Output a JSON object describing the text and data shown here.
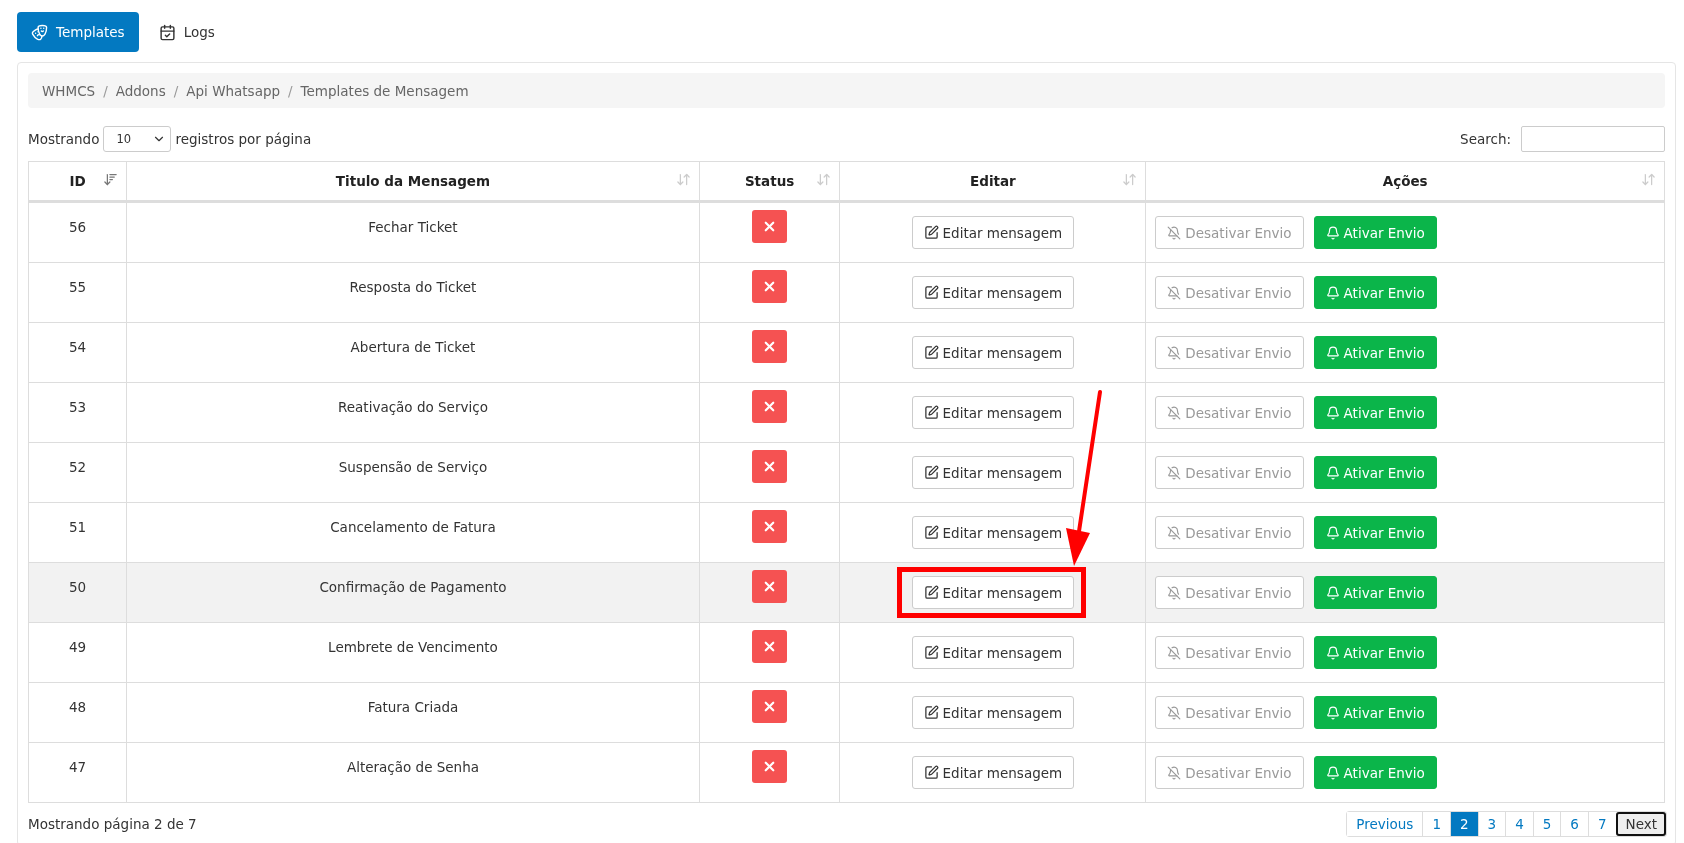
{
  "tabs": [
    {
      "label": "Templates",
      "selected": true
    },
    {
      "label": "Logs",
      "selected": false
    }
  ],
  "breadcrumb": {
    "items": [
      "WHMCS",
      "Addons",
      "Api Whatsapp",
      "Templates de Mensagem"
    ],
    "separators": [
      "/",
      "/",
      "/"
    ]
  },
  "length_control": {
    "prefix": "Mostrando",
    "value": "10",
    "suffix": "registros por página"
  },
  "search": {
    "label": "Search:"
  },
  "table": {
    "columns": [
      {
        "label": "ID",
        "sorted": true
      },
      {
        "label": "Titulo da Mensagem",
        "sorted": false
      },
      {
        "label": "Status",
        "sorted": false
      },
      {
        "label": "Editar",
        "sorted": false
      },
      {
        "label": "Ações",
        "sorted": false
      }
    ],
    "rows": [
      {
        "id": "56",
        "title": "Fechar Ticket",
        "active": false,
        "edit": "Editar mensagem",
        "disable": "Desativar Envio",
        "enable": "Ativar Envio",
        "highlighted": false,
        "annotated": false
      },
      {
        "id": "55",
        "title": "Resposta do Ticket",
        "active": false,
        "edit": "Editar mensagem",
        "disable": "Desativar Envio",
        "enable": "Ativar Envio",
        "highlighted": false,
        "annotated": false
      },
      {
        "id": "54",
        "title": "Abertura de Ticket",
        "active": false,
        "edit": "Editar mensagem",
        "disable": "Desativar Envio",
        "enable": "Ativar Envio",
        "highlighted": false,
        "annotated": false
      },
      {
        "id": "53",
        "title": "Reativação do Serviço",
        "active": false,
        "edit": "Editar mensagem",
        "disable": "Desativar Envio",
        "enable": "Ativar Envio",
        "highlighted": false,
        "annotated": false
      },
      {
        "id": "52",
        "title": "Suspensão de Serviço",
        "active": false,
        "edit": "Editar mensagem",
        "disable": "Desativar Envio",
        "enable": "Ativar Envio",
        "highlighted": false,
        "annotated": false
      },
      {
        "id": "51",
        "title": "Cancelamento de Fatura",
        "active": false,
        "edit": "Editar mensagem",
        "disable": "Desativar Envio",
        "enable": "Ativar Envio",
        "highlighted": false,
        "annotated": false
      },
      {
        "id": "50",
        "title": "Confirmação de Pagamento",
        "active": false,
        "edit": "Editar mensagem",
        "disable": "Desativar Envio",
        "enable": "Ativar Envio",
        "highlighted": true,
        "annotated": true
      },
      {
        "id": "49",
        "title": "Lembrete de Vencimento",
        "active": false,
        "edit": "Editar mensagem",
        "disable": "Desativar Envio",
        "enable": "Ativar Envio",
        "highlighted": false,
        "annotated": false
      },
      {
        "id": "48",
        "title": "Fatura Criada",
        "active": false,
        "edit": "Editar mensagem",
        "disable": "Desativar Envio",
        "enable": "Ativar Envio",
        "highlighted": false,
        "annotated": false
      },
      {
        "id": "47",
        "title": "Alteração de Senha",
        "active": false,
        "edit": "Editar mensagem",
        "disable": "Desativar Envio",
        "enable": "Ativar Envio",
        "highlighted": false,
        "annotated": false
      }
    ]
  },
  "footer": {
    "info": "Mostrando página 2 de 7"
  },
  "pagination": {
    "previous": {
      "label": "Previous",
      "focused": false
    },
    "pages": [
      {
        "label": "1",
        "selected": false
      },
      {
        "label": "2",
        "selected": true
      },
      {
        "label": "3",
        "selected": false
      },
      {
        "label": "4",
        "selected": false
      },
      {
        "label": "5",
        "selected": false
      },
      {
        "label": "6",
        "selected": false
      },
      {
        "label": "7",
        "selected": false
      }
    ],
    "next": {
      "label": "Next",
      "focused": true
    }
  }
}
